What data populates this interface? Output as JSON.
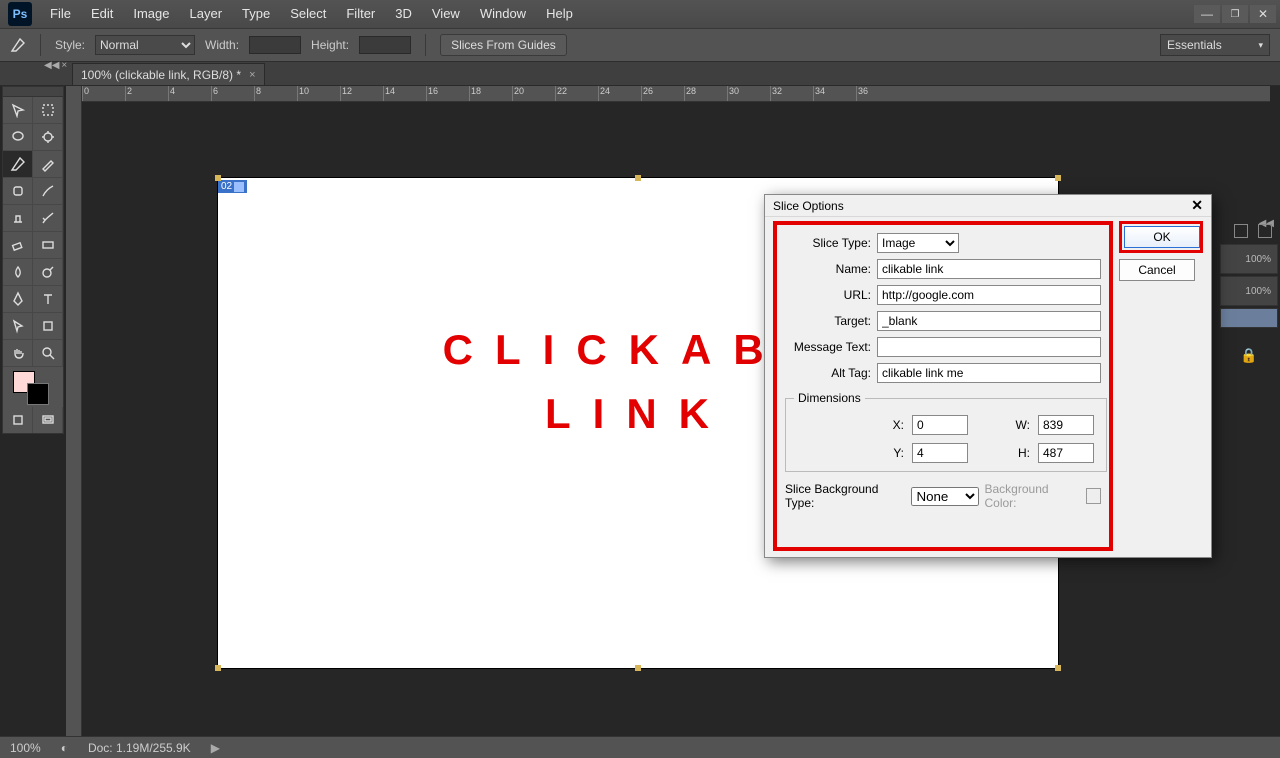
{
  "menu": {
    "items": [
      "File",
      "Edit",
      "Image",
      "Layer",
      "Type",
      "Select",
      "Filter",
      "3D",
      "View",
      "Window",
      "Help"
    ]
  },
  "options": {
    "style_label": "Style:",
    "style_value": "Normal",
    "width_label": "Width:",
    "height_label": "Height:",
    "slices_button": "Slices From Guides",
    "workspace": "Essentials"
  },
  "doc_tab": {
    "title": "100% (clickable link, RGB/8) *"
  },
  "ruler_ticks": [
    "0",
    "2",
    "4",
    "6",
    "8",
    "10",
    "12",
    "14",
    "16",
    "18",
    "20",
    "22",
    "24",
    "26",
    "28",
    "30",
    "32",
    "34",
    "36"
  ],
  "canvas": {
    "slice_badge": "02",
    "line1": "CLICKABL",
    "line2": "LINK"
  },
  "dialog": {
    "title": "Slice Options",
    "ok": "OK",
    "cancel": "Cancel",
    "slice_type_label": "Slice Type:",
    "slice_type_value": "Image",
    "name_label": "Name:",
    "name_value": "clikable link",
    "url_label": "URL:",
    "url_value": "http://google.com",
    "target_label": "Target:",
    "target_value": "_blank",
    "message_label": "Message Text:",
    "message_value": "",
    "alt_label": "Alt Tag:",
    "alt_value": "clikable link me",
    "dimensions_legend": "Dimensions",
    "x_label": "X:",
    "x_value": "0",
    "y_label": "Y:",
    "y_value": "4",
    "w_label": "W:",
    "w_value": "839",
    "h_label": "H:",
    "h_value": "487",
    "bgtype_label": "Slice Background Type:",
    "bgtype_value": "None",
    "bgcolor_label": "Background Color:"
  },
  "right_panels": {
    "opacity1": "100%",
    "opacity2": "100%"
  },
  "status": {
    "zoom": "100%",
    "doc_size": "Doc: 1.19M/255.9K"
  },
  "colors": {
    "fg": "#ffd8d8",
    "bg": "#000000",
    "accent_red": "#e30000"
  }
}
